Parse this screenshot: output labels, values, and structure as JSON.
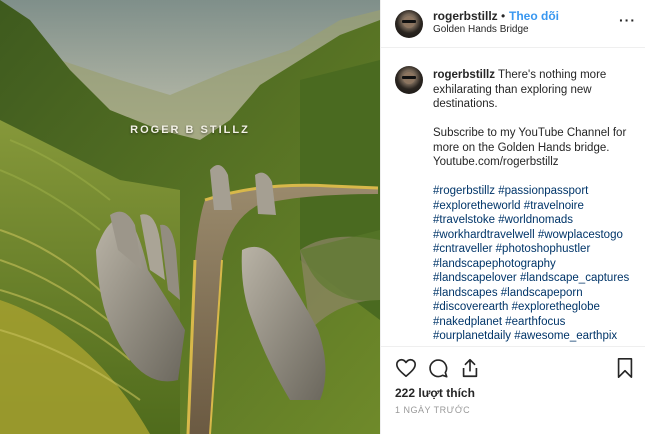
{
  "post": {
    "watermark": "ROGER B STILLZ",
    "image_icon": "photo-golden-hands-bridge"
  },
  "header": {
    "username": "rogerbstillz",
    "separator": "•",
    "follow_label": "Theo dõi",
    "location": "Golden Hands Bridge",
    "more_icon": "ellipsis-icon",
    "more_glyph": "···"
  },
  "caption": {
    "username": "rogerbstillz",
    "text1": "There's nothing more exhilarating than exploring new destinations.",
    "text2": "Subscribe to my YouTube Channel for more on the Golden Hands bridge. Youtube.com/rogerbstillz",
    "hashtags": [
      "#rogerbstillz",
      "#passionpassport",
      "#exploretheworld",
      "#travelnoire",
      "#travelstoke",
      "#worldnomads",
      "#workhardtravelwell",
      "#wowplacestogo",
      "#cntraveller",
      "#photoshophustler",
      "#landscapephotography",
      "#landscapelover",
      "#landscape_captures",
      "#landscapes",
      "#landscapeporn",
      "#discoverearth",
      "#exploretheglobe",
      "#nakedplanet",
      "#earthfocus",
      "#ourplanetdaily",
      "#awesome_earthpix"
    ]
  },
  "actions": {
    "like_icon": "heart-icon",
    "comment_icon": "comment-icon",
    "share_icon": "share-icon",
    "save_icon": "bookmark-icon"
  },
  "likes_text": "222 lượt thích",
  "time_text": "1 NGÀY TRƯỚC"
}
